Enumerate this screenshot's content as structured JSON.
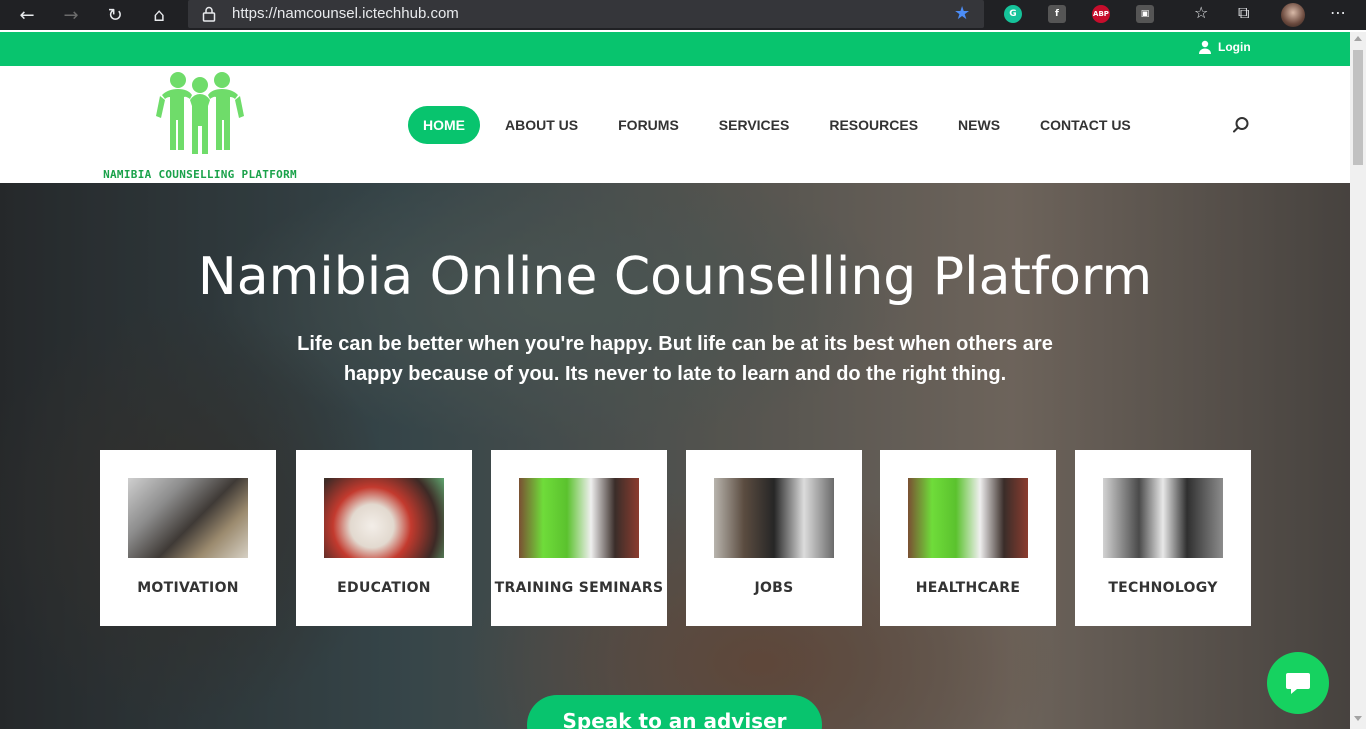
{
  "browser": {
    "url": "https://namcounsel.ictechhub.com",
    "extensions": [
      {
        "name": "grammarly-icon",
        "glyph": "G",
        "color": "#15c39a"
      },
      {
        "name": "facebook-icon",
        "glyph": "f",
        "color": "#555555"
      },
      {
        "name": "adblock-icon",
        "glyph": "ABP",
        "color": "#c70d2c"
      },
      {
        "name": "extension-icon",
        "glyph": "▣",
        "color": "#555555"
      }
    ]
  },
  "topbar": {
    "login_label": "Login"
  },
  "site": {
    "logo_text": "NAMIBIA COUNSELLING PLATFORM"
  },
  "menu": [
    "HOME",
    "ABOUT US",
    "FORUMS",
    "SERVICES",
    "RESOURCES",
    "NEWS",
    "CONTACT US"
  ],
  "hero": {
    "title": "Namibia Online Counselling Platform",
    "subtitle": "Life can be better when you're happy. But life can be at its best when others are happy because of you. Its never to late to learn and do the right thing."
  },
  "categories": [
    "MOTIVATION",
    "EDUCATION",
    "TRAINING SEMINARS",
    "JOBS",
    "HEALTHCARE",
    "TECHNOLOGY"
  ],
  "cta": {
    "label": "Speak to an adviser"
  },
  "colors": {
    "brand_green": "#08c46e",
    "chat_green": "#16d260"
  }
}
